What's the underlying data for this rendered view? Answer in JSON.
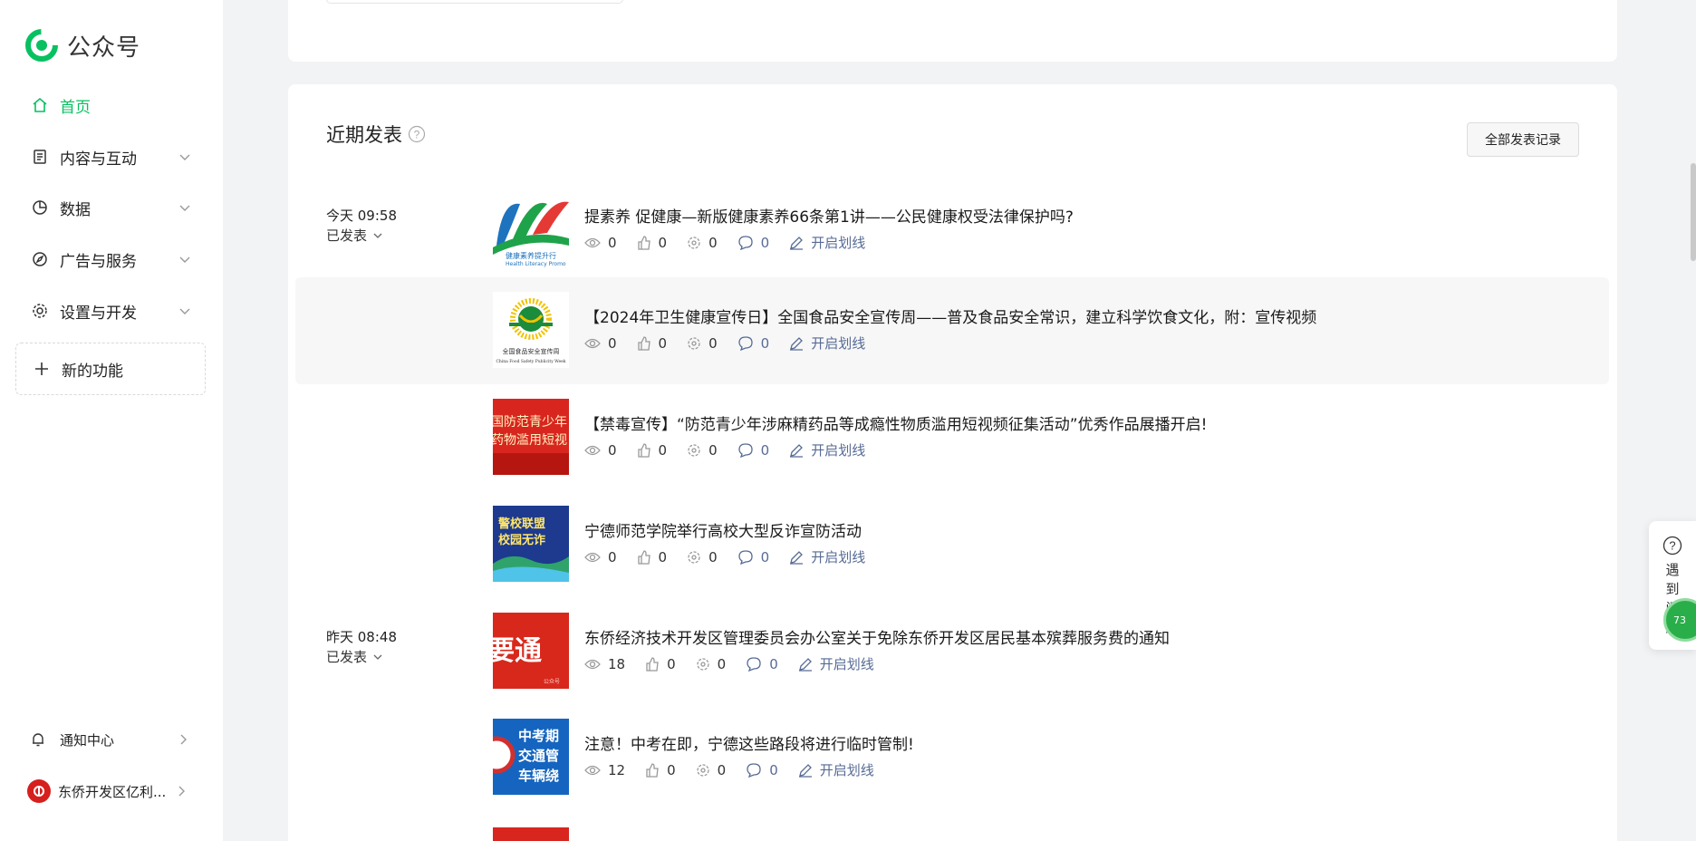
{
  "brand": {
    "name": "公众号"
  },
  "nav": {
    "home": "首页",
    "content": "内容与互动",
    "data": "数据",
    "ads": "广告与服务",
    "settings": "设置与开发",
    "new_features": "新的功能"
  },
  "bottom": {
    "notifications": "通知中心",
    "account": "东侨开发区亿利..."
  },
  "section": {
    "title": "近期发表",
    "all_button": "全部发表记录"
  },
  "posts": [
    {
      "date": "今天 09:58",
      "status": "已发表",
      "title": "提素养 促健康—新版健康素养66条第1讲——公民健康权受法律保护吗?",
      "views": "0",
      "likes": "0",
      "shares": "0",
      "comments": "0",
      "mark": "开启划线",
      "thumb_text": "健康素养提升行",
      "thumb_sub": "Health Literacy Promo"
    },
    {
      "date": "",
      "status": "",
      "title": "【2024年卫生健康宣传日】全国食品安全宣传周——普及食品安全常识，建立科学饮食文化，附：宣传视频",
      "views": "0",
      "likes": "0",
      "shares": "0",
      "comments": "0",
      "mark": "开启划线",
      "thumb_text": "全国食品安全宣传周",
      "thumb_sub": "China Food Safety Publicity Week"
    },
    {
      "date": "",
      "status": "",
      "title": "【禁毒宣传】“防范青少年涉麻精药品等成瘾性物质滥用短视频征集活动”优秀作品展播开启!",
      "views": "0",
      "likes": "0",
      "shares": "0",
      "comments": "0",
      "mark": "开启划线",
      "thumb_text": "国防范青少年",
      "thumb_sub": "药物滥用短视"
    },
    {
      "date": "",
      "status": "",
      "title": "宁德师范学院举行高校大型反诈宣防活动",
      "views": "0",
      "likes": "0",
      "shares": "0",
      "comments": "0",
      "mark": "开启划线",
      "thumb_text": "警校联盟",
      "thumb_sub": "校园无诈"
    },
    {
      "date": "昨天 08:48",
      "status": "已发表",
      "title": "东侨经济技术开发区管理委员会办公室关于免除东侨开发区居民基本殡葬服务费的通知",
      "views": "18",
      "likes": "0",
      "shares": "0",
      "comments": "0",
      "mark": "开启划线",
      "thumb_text": "要通",
      "thumb_sub": "公众号"
    },
    {
      "date": "",
      "status": "",
      "title": "注意！中考在即，宁德这些路段将进行临时管制!",
      "views": "12",
      "likes": "0",
      "shares": "0",
      "comments": "0",
      "mark": "开启划线",
      "thumb_text": "中考期",
      "thumb_sub": "交通管",
      "thumb_sub2": "车辆绕"
    }
  ],
  "help_widget": {
    "text": "遇到问题",
    "badge": "73"
  },
  "colors": {
    "accent": "#07c160",
    "link": "#576b95"
  }
}
